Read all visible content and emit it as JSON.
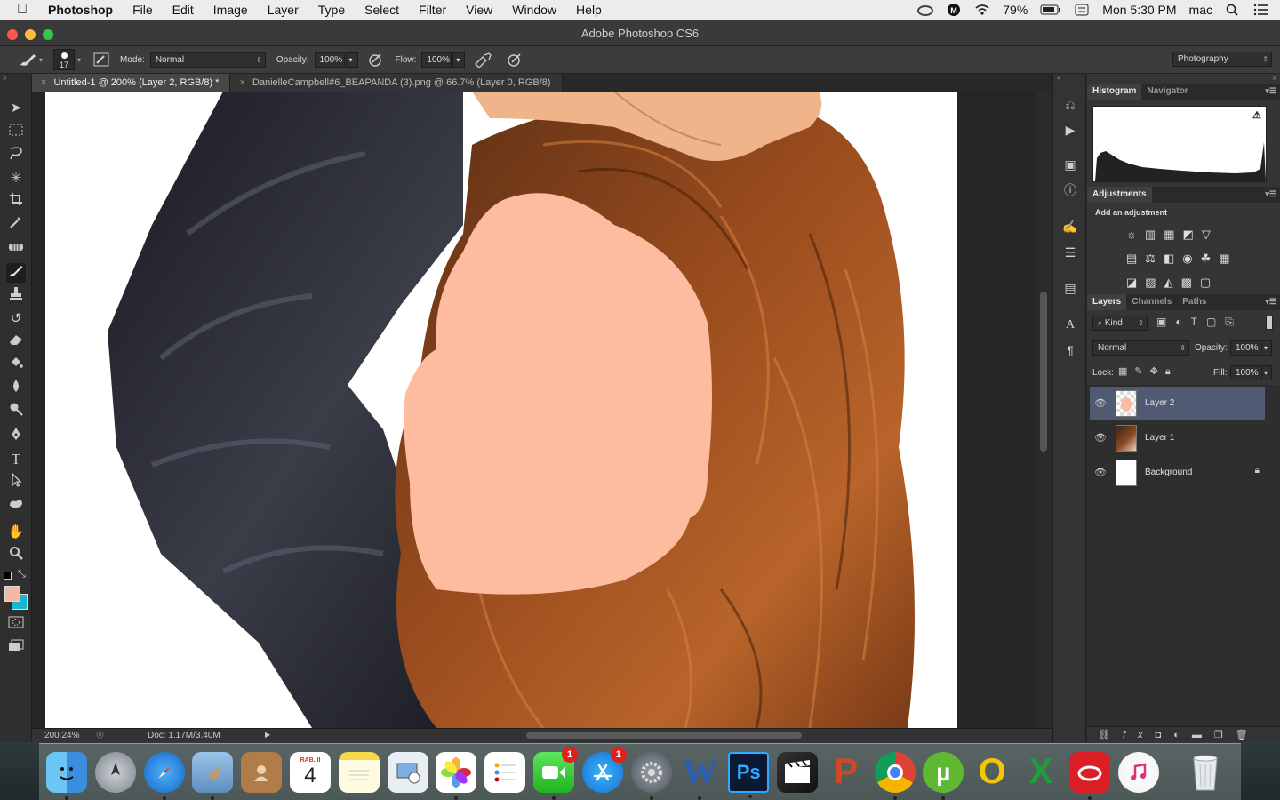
{
  "menubar": {
    "app": "Photoshop",
    "items": [
      "File",
      "Edit",
      "Image",
      "Layer",
      "Type",
      "Select",
      "Filter",
      "View",
      "Window",
      "Help"
    ],
    "battery": "79%",
    "clock": "Mon 5:30 PM",
    "user": "mac"
  },
  "window": {
    "title": "Adobe Photoshop CS6"
  },
  "options": {
    "brush_size": "17",
    "mode_label": "Mode:",
    "mode_value": "Normal",
    "opacity_label": "Opacity:",
    "opacity_value": "100%",
    "flow_label": "Flow:",
    "flow_value": "100%",
    "workspace": "Photography"
  },
  "tabs": [
    {
      "label": "Untitled-1 @ 200% (Layer 2, RGB/8) *"
    },
    {
      "label": "DanielleCampbell#6_BEAPANDA (3).png @ 66.7% (Layer 0, RGB/8)"
    }
  ],
  "status": {
    "zoom": "200.24%",
    "doc": "Doc: 1.17M/3.40M"
  },
  "panels": {
    "histogram_tabs": [
      "Histogram",
      "Navigator"
    ],
    "adjustments_tab": "Adjustments",
    "adjustments_hint": "Add an adjustment",
    "layers_tabs": [
      "Layers",
      "Channels",
      "Paths"
    ],
    "kind_label": "Kind",
    "blend_mode": "Normal",
    "opacity_label": "Opacity:",
    "opacity_value": "100%",
    "lock_label": "Lock:",
    "fill_label": "Fill:",
    "fill_value": "100%",
    "layers": [
      {
        "name": "Layer 2",
        "selected": true
      },
      {
        "name": "Layer 1",
        "selected": false
      },
      {
        "name": "Background",
        "selected": false
      }
    ]
  },
  "dock": {
    "calendar_month": "RAB. II",
    "calendar_day": "4",
    "facetime_badge": "1",
    "appstore_badge": "1",
    "items": [
      "finder-icon",
      "launchpad-icon",
      "safari-icon",
      "mail-icon",
      "contacts-icon",
      "calendar-icon",
      "notes-icon",
      "preview-icon",
      "photos-icon",
      "reminders-icon",
      "facetime-icon",
      "app-store-icon",
      "system-preferences-icon",
      "word-icon",
      "photoshop-icon",
      "final-cut-icon",
      "powerpoint-icon",
      "chrome-icon",
      "utorrent-icon",
      "outlook-icon",
      "excel-icon",
      "creative-cloud-icon",
      "itunes-icon",
      "trash-icon"
    ]
  },
  "colors": {
    "foreground": "#f6b8a6",
    "background": "#16b7cf",
    "skin_patch": "#fdbb9f",
    "selected_layer": "#515a73"
  }
}
